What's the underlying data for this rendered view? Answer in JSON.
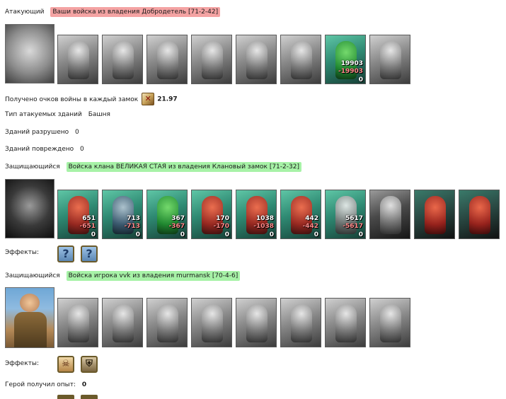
{
  "attacker": {
    "label": "Атакующий",
    "tag": "Ваши войска из владения Добродетель [71-2-42]",
    "emblem_icon": "crossed-swords-crest-icon",
    "units": [
      {
        "icon": "dwarf-unit-icon",
        "style": "gray"
      },
      {
        "icon": "swordsman-unit-icon",
        "style": "gray"
      },
      {
        "icon": "knight-unit-icon",
        "style": "gray"
      },
      {
        "icon": "gryphon-unit-icon",
        "style": "gray"
      },
      {
        "icon": "archer-unit-icon",
        "style": "gray"
      },
      {
        "icon": "monk-unit-icon",
        "style": "gray"
      },
      {
        "icon": "green-druid-unit-icon",
        "style": "green",
        "count": "19903",
        "lost": "-19903",
        "remaining": "0"
      },
      {
        "icon": "mage-unit-icon",
        "style": "gray"
      }
    ]
  },
  "war_points": {
    "label": "Получено очков войны в каждый замок",
    "icon": "war-points-icon",
    "value": "21.97"
  },
  "building_type": {
    "label": "Тип атакуемых зданий",
    "value": "Башня"
  },
  "destroyed": {
    "label": "Зданий разрушено",
    "value": "0"
  },
  "damaged": {
    "label": "Зданий повреждено",
    "value": "0"
  },
  "defender_clan": {
    "label": "Защищающийся",
    "tag": "Войска клана ВЕЛИКАЯ СТАЯ из владения Клановый замок [71-2-32]",
    "emblem_icon": "demon-mask-crest-icon",
    "units": [
      {
        "icon": "lizard-unit-icon",
        "style": "green",
        "fig": "r",
        "count": "651",
        "lost": "-651",
        "remaining": "0"
      },
      {
        "icon": "ogre-unit-icon",
        "style": "green",
        "fig": "b",
        "count": "713",
        "lost": "-713",
        "remaining": "0"
      },
      {
        "icon": "orc-unit-icon",
        "style": "green",
        "fig": "gr",
        "count": "367",
        "lost": "-367",
        "remaining": "0"
      },
      {
        "icon": "red-demon-unit-icon",
        "style": "green",
        "fig": "r",
        "count": "170",
        "lost": "-170",
        "remaining": "0"
      },
      {
        "icon": "spider-unit-icon",
        "style": "green",
        "fig": "r",
        "count": "1038",
        "lost": "-1038",
        "remaining": "0"
      },
      {
        "icon": "dragon-unit-icon",
        "style": "green",
        "fig": "r",
        "count": "442",
        "lost": "-442",
        "remaining": "0"
      },
      {
        "icon": "spiked-beast-unit-icon",
        "style": "green",
        "fig": "g",
        "count": "5617",
        "lost": "-5617",
        "remaining": "0"
      },
      {
        "icon": "gray-beast-unit-icon",
        "style": "darkgray"
      },
      {
        "icon": "tower-structure-icon",
        "style": "redbg",
        "fig": "r"
      },
      {
        "icon": "pink-crystal-unit-icon",
        "style": "redbg",
        "fig": "r"
      }
    ],
    "effects_label": "Эффекты:",
    "effects": [
      {
        "icon": "unknown-effect-icon",
        "glyph": "?"
      },
      {
        "icon": "unknown-effect-icon",
        "glyph": "?"
      }
    ]
  },
  "defender_player": {
    "label": "Защищающийся",
    "tag": "Войска игрока vvk из владения murmansk [70-4-6]",
    "emblem_icon": "hero-portrait-icon",
    "units": [
      {
        "icon": "armored-soldier-unit-icon",
        "style": "gray"
      },
      {
        "icon": "crossbowman-unit-icon",
        "style": "gray"
      },
      {
        "icon": "cavalry-unit-icon",
        "style": "gray"
      },
      {
        "icon": "horse-unit-icon",
        "style": "gray"
      },
      {
        "icon": "ballista-unit-icon",
        "style": "gray"
      },
      {
        "icon": "hooded-unit-icon",
        "style": "gray"
      },
      {
        "icon": "warrior-unit-icon",
        "style": "gray"
      },
      {
        "icon": "blade-unit-icon",
        "style": "gray"
      }
    ],
    "effects_label": "Эффекты:",
    "effects": [
      {
        "icon": "skull-effect-icon",
        "glyph": "☠"
      },
      {
        "icon": "shield-effect-icon",
        "glyph": "⛨"
      }
    ]
  },
  "hero_exp": {
    "label": "Герой получил опыт:",
    "value": "0"
  }
}
